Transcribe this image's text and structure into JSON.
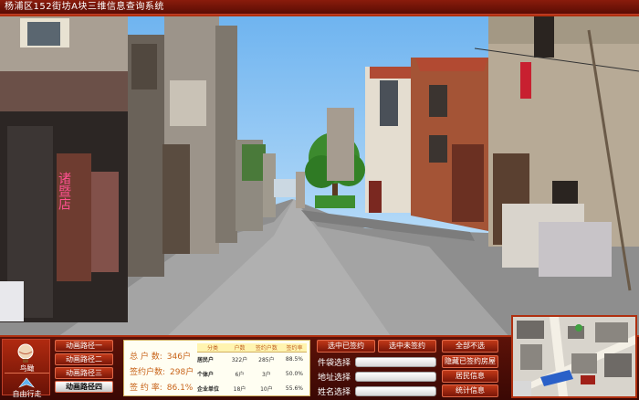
{
  "window": {
    "title": "杨浦区152街坊A块三维信息查询系统"
  },
  "scene": {
    "shop_sign": "诸暨店"
  },
  "modes": {
    "aerial_label": "鸟瞰",
    "free_label": "自由行走"
  },
  "animation_paths": [
    {
      "label": "动画路径一",
      "selected": false
    },
    {
      "label": "动画路径二",
      "selected": false
    },
    {
      "label": "动画路径三",
      "selected": false
    },
    {
      "label": "动画路径四",
      "selected": true
    }
  ],
  "stats": {
    "total_label": "总 户 数:",
    "total_value": "346户",
    "signed_label": "签约户数:",
    "signed_value": "298户",
    "rate_label": "签 约 率:",
    "rate_value": "86.1%"
  },
  "table": {
    "headers": [
      "分类",
      "户数",
      "签约户数",
      "签约率"
    ],
    "rows": [
      {
        "cat": "居民户",
        "count": "322户",
        "signed": "285户",
        "rate": "88.5%"
      },
      {
        "cat": "个体户",
        "count": "6户",
        "signed": "3户",
        "rate": "50.0%"
      },
      {
        "cat": "企业单位",
        "count": "18户",
        "signed": "10户",
        "rate": "55.6%"
      }
    ]
  },
  "actions": {
    "select_signed": "选中已签约",
    "select_unsigned": "选中未签约",
    "deselect_all": "全部不选",
    "hide_signed": "隐藏已签约房屋",
    "resident_info": "居民信息",
    "stats_info": "统计信息"
  },
  "filters": {
    "parcel_label": "件袋选择",
    "address_label": "地址选择",
    "name_label": "姓名选择"
  },
  "colors": {
    "accent": "#b03010",
    "stat_text": "#c8641a",
    "panel": "#4a0c06"
  }
}
